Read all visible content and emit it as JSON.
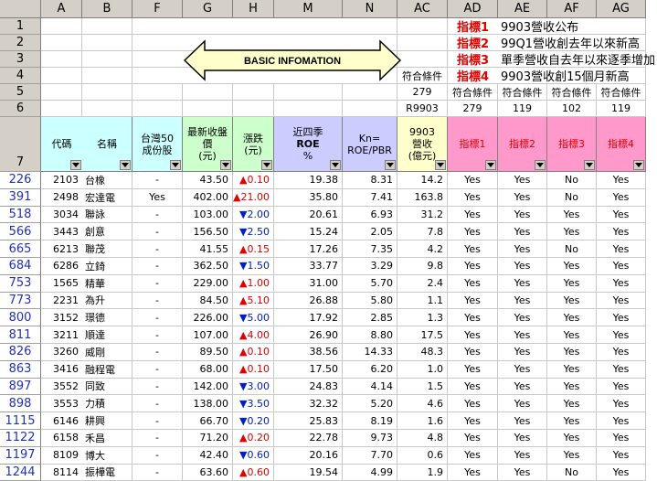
{
  "columns": [
    "A",
    "B",
    "F",
    "G",
    "H",
    "M",
    "N",
    "AC",
    "AD",
    "AE",
    "AF",
    "AG"
  ],
  "top_rows": [
    "1",
    "2",
    "3",
    "4",
    "5",
    "6"
  ],
  "header_row": "7",
  "indicators": [
    {
      "label": "指標1",
      "text": "9903營收公布"
    },
    {
      "label": "指標2",
      "text": "99Q1營收創去年以來新高"
    },
    {
      "label": "指標3",
      "text": "單季營收自去年以來逐季增加"
    },
    {
      "label": "指標4",
      "text": "9903營收創15個月新高"
    }
  ],
  "banner": "BASIC INFOMATION",
  "row4_ac": "符合條件",
  "row5": {
    "ac": "279",
    "ad": "符合條件",
    "ae": "符合條件",
    "af": "符合條件",
    "ag": "符合條件"
  },
  "row6": {
    "ac": "R9903",
    "ad": "279",
    "ae": "119",
    "af": "102",
    "ag": "119"
  },
  "headers": {
    "code": "代碼",
    "name": "名稱",
    "tw50": [
      "台灣50",
      "成份股"
    ],
    "price": [
      "最新收盤價",
      "(元)"
    ],
    "chg": [
      "漲跌",
      "(元)"
    ],
    "roe": [
      "近四季",
      "ROE",
      "%"
    ],
    "kn": [
      "Kn=",
      "ROE/PBR"
    ],
    "rev": [
      "9903",
      "營收",
      "(億元)"
    ],
    "i1": "指標1",
    "i2": "指標2",
    "i3": "指標3",
    "i4": "指標4"
  },
  "rows": [
    {
      "row": "226",
      "code": "2103",
      "name": "台橡",
      "tw50": "-",
      "price": "43.50",
      "chg": "▲0.10",
      "dir": "up",
      "roe": "19.38",
      "kn": "8.31",
      "rev": "14.2",
      "i1": "Yes",
      "i2": "Yes",
      "i3": "No",
      "i4": "Yes"
    },
    {
      "row": "391",
      "code": "2498",
      "name": "宏達電",
      "tw50": "Yes",
      "price": "402.00",
      "chg": "▲21.00",
      "dir": "up",
      "roe": "35.80",
      "kn": "7.41",
      "rev": "163.8",
      "i1": "Yes",
      "i2": "Yes",
      "i3": "No",
      "i4": "Yes"
    },
    {
      "row": "518",
      "code": "3034",
      "name": "聯詠",
      "tw50": "-",
      "price": "103.00",
      "chg": "▼2.00",
      "dir": "down",
      "roe": "20.61",
      "kn": "6.93",
      "rev": "31.2",
      "i1": "Yes",
      "i2": "Yes",
      "i3": "Yes",
      "i4": "Yes"
    },
    {
      "row": "566",
      "code": "3443",
      "name": "創意",
      "tw50": "-",
      "price": "156.50",
      "chg": "▼2.50",
      "dir": "down",
      "roe": "15.24",
      "kn": "2.05",
      "rev": "7.8",
      "i1": "Yes",
      "i2": "Yes",
      "i3": "Yes",
      "i4": "Yes"
    },
    {
      "row": "665",
      "code": "6213",
      "name": "聯茂",
      "tw50": "-",
      "price": "41.55",
      "chg": "▲0.15",
      "dir": "up",
      "roe": "17.26",
      "kn": "7.35",
      "rev": "4.2",
      "i1": "Yes",
      "i2": "Yes",
      "i3": "No",
      "i4": "Yes"
    },
    {
      "row": "684",
      "code": "6286",
      "name": "立錡",
      "tw50": "-",
      "price": "362.50",
      "chg": "▼1.50",
      "dir": "down",
      "roe": "33.77",
      "kn": "3.29",
      "rev": "9.8",
      "i1": "Yes",
      "i2": "Yes",
      "i3": "Yes",
      "i4": "Yes"
    },
    {
      "row": "753",
      "code": "1565",
      "name": "精華",
      "tw50": "-",
      "price": "229.00",
      "chg": "▲1.00",
      "dir": "up",
      "roe": "31.00",
      "kn": "5.70",
      "rev": "2.4",
      "i1": "Yes",
      "i2": "Yes",
      "i3": "Yes",
      "i4": "Yes"
    },
    {
      "row": "773",
      "code": "2231",
      "name": "為升",
      "tw50": "-",
      "price": "84.50",
      "chg": "▲5.10",
      "dir": "up",
      "roe": "26.88",
      "kn": "5.80",
      "rev": "1.1",
      "i1": "Yes",
      "i2": "Yes",
      "i3": "Yes",
      "i4": "Yes"
    },
    {
      "row": "800",
      "code": "3152",
      "name": "璟德",
      "tw50": "-",
      "price": "226.00",
      "chg": "▼5.00",
      "dir": "down",
      "roe": "17.92",
      "kn": "2.85",
      "rev": "1.3",
      "i1": "Yes",
      "i2": "Yes",
      "i3": "Yes",
      "i4": "Yes"
    },
    {
      "row": "811",
      "code": "3211",
      "name": "順達",
      "tw50": "-",
      "price": "107.00",
      "chg": "▲4.00",
      "dir": "up",
      "roe": "26.90",
      "kn": "8.80",
      "rev": "17.5",
      "i1": "Yes",
      "i2": "Yes",
      "i3": "Yes",
      "i4": "Yes"
    },
    {
      "row": "826",
      "code": "3260",
      "name": "威剛",
      "tw50": "-",
      "price": "89.50",
      "chg": "▲0.10",
      "dir": "up",
      "roe": "38.56",
      "kn": "14.33",
      "rev": "48.3",
      "i1": "Yes",
      "i2": "Yes",
      "i3": "Yes",
      "i4": "Yes"
    },
    {
      "row": "863",
      "code": "3416",
      "name": "融程電",
      "tw50": "-",
      "price": "68.00",
      "chg": "▲0.10",
      "dir": "up",
      "roe": "17.50",
      "kn": "6.20",
      "rev": "1.0",
      "i1": "Yes",
      "i2": "Yes",
      "i3": "Yes",
      "i4": "Yes"
    },
    {
      "row": "897",
      "code": "3552",
      "name": "同致",
      "tw50": "-",
      "price": "142.00",
      "chg": "▼3.00",
      "dir": "down",
      "roe": "24.83",
      "kn": "4.14",
      "rev": "1.5",
      "i1": "Yes",
      "i2": "Yes",
      "i3": "Yes",
      "i4": "Yes"
    },
    {
      "row": "898",
      "code": "3553",
      "name": "力積",
      "tw50": "-",
      "price": "138.00",
      "chg": "▼3.50",
      "dir": "down",
      "roe": "32.32",
      "kn": "5.20",
      "rev": "4.6",
      "i1": "Yes",
      "i2": "Yes",
      "i3": "Yes",
      "i4": "Yes"
    },
    {
      "row": "1115",
      "code": "6146",
      "name": "耕興",
      "tw50": "-",
      "price": "66.70",
      "chg": "▼0.20",
      "dir": "down",
      "roe": "25.83",
      "kn": "8.19",
      "rev": "1.6",
      "i1": "Yes",
      "i2": "Yes",
      "i3": "Yes",
      "i4": "Yes"
    },
    {
      "row": "1122",
      "code": "6158",
      "name": "禾昌",
      "tw50": "-",
      "price": "71.20",
      "chg": "▲0.20",
      "dir": "up",
      "roe": "22.78",
      "kn": "9.73",
      "rev": "4.8",
      "i1": "Yes",
      "i2": "Yes",
      "i3": "Yes",
      "i4": "Yes"
    },
    {
      "row": "1197",
      "code": "8109",
      "name": "博大",
      "tw50": "-",
      "price": "42.40",
      "chg": "▼0.60",
      "dir": "down",
      "roe": "20.16",
      "kn": "7.70",
      "rev": "0.6",
      "i1": "Yes",
      "i2": "Yes",
      "i3": "Yes",
      "i4": "Yes"
    },
    {
      "row": "1244",
      "code": "8114",
      "name": "振樺電",
      "tw50": "-",
      "price": "63.60",
      "chg": "▲0.60",
      "dir": "up",
      "roe": "19.54",
      "kn": "4.99",
      "rev": "1.9",
      "i1": "Yes",
      "i2": "Yes",
      "i3": "No",
      "i4": "Yes"
    }
  ],
  "colors": {
    "header_gray": "#d4d0c8",
    "cyan": "#ccffff",
    "green": "#ccffcc",
    "lavender": "#ccccff",
    "yellow": "#ffffcc",
    "pink": "#ff99cc",
    "up": "#e00000",
    "down": "#0020c0"
  }
}
